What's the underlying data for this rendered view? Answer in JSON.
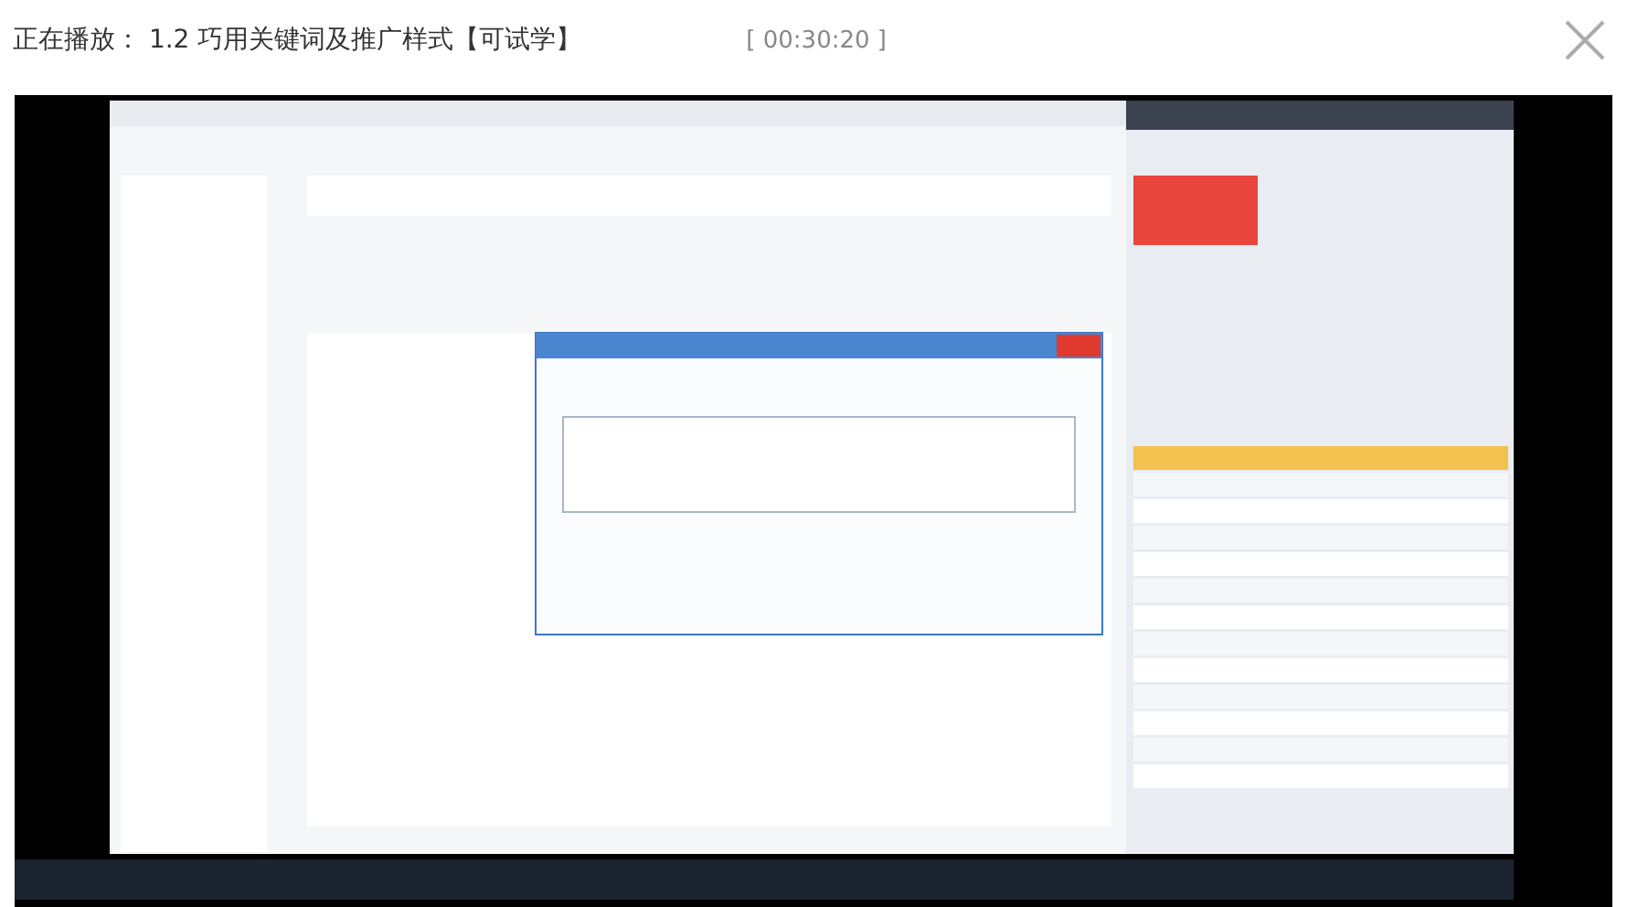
{
  "player": {
    "now_playing": "正在播放： 1.2 巧用关键词及推广样式【可试学】",
    "time": "[ 00:30:20 ]"
  }
}
